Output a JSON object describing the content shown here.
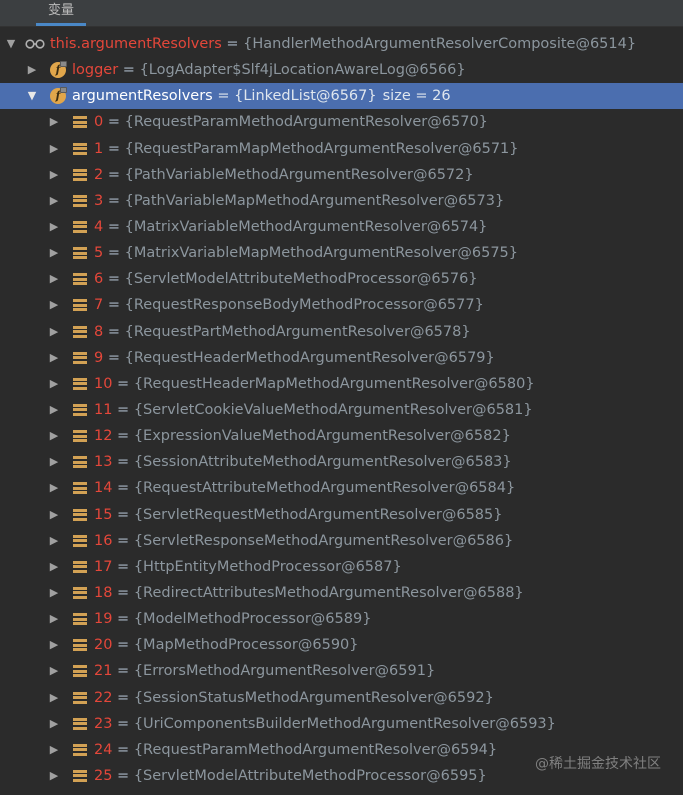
{
  "tab": {
    "label": "变量"
  },
  "root": {
    "name": "this.argumentResolvers",
    "eq": " = ",
    "value": "{HandlerMethodArgumentResolverComposite@6514}"
  },
  "logger": {
    "name": "logger",
    "eq": " = ",
    "value": "{LogAdapter$Slf4jLocationAwareLog@6566}"
  },
  "resolvers": {
    "name": "argumentResolvers",
    "eq": " = ",
    "value": "{LinkedList@6567}",
    "size": "size = 26"
  },
  "items": [
    {
      "index": "0",
      "value": "{RequestParamMethodArgumentResolver@6570}"
    },
    {
      "index": "1",
      "value": "{RequestParamMapMethodArgumentResolver@6571}"
    },
    {
      "index": "2",
      "value": "{PathVariableMethodArgumentResolver@6572}"
    },
    {
      "index": "3",
      "value": "{PathVariableMapMethodArgumentResolver@6573}"
    },
    {
      "index": "4",
      "value": "{MatrixVariableMethodArgumentResolver@6574}"
    },
    {
      "index": "5",
      "value": "{MatrixVariableMapMethodArgumentResolver@6575}"
    },
    {
      "index": "6",
      "value": "{ServletModelAttributeMethodProcessor@6576}"
    },
    {
      "index": "7",
      "value": "{RequestResponseBodyMethodProcessor@6577}"
    },
    {
      "index": "8",
      "value": "{RequestPartMethodArgumentResolver@6578}"
    },
    {
      "index": "9",
      "value": "{RequestHeaderMethodArgumentResolver@6579}"
    },
    {
      "index": "10",
      "value": "{RequestHeaderMapMethodArgumentResolver@6580}"
    },
    {
      "index": "11",
      "value": "{ServletCookieValueMethodArgumentResolver@6581}"
    },
    {
      "index": "12",
      "value": "{ExpressionValueMethodArgumentResolver@6582}"
    },
    {
      "index": "13",
      "value": "{SessionAttributeMethodArgumentResolver@6583}"
    },
    {
      "index": "14",
      "value": "{RequestAttributeMethodArgumentResolver@6584}"
    },
    {
      "index": "15",
      "value": "{ServletRequestMethodArgumentResolver@6585}"
    },
    {
      "index": "16",
      "value": "{ServletResponseMethodArgumentResolver@6586}"
    },
    {
      "index": "17",
      "value": "{HttpEntityMethodProcessor@6587}"
    },
    {
      "index": "18",
      "value": "{RedirectAttributesMethodArgumentResolver@6588}"
    },
    {
      "index": "19",
      "value": "{ModelMethodProcessor@6589}"
    },
    {
      "index": "20",
      "value": "{MapMethodProcessor@6590}"
    },
    {
      "index": "21",
      "value": "{ErrorsMethodArgumentResolver@6591}"
    },
    {
      "index": "22",
      "value": "{SessionStatusMethodArgumentResolver@6592}"
    },
    {
      "index": "23",
      "value": "{UriComponentsBuilderMethodArgumentResolver@6593}"
    },
    {
      "index": "24",
      "value": "{RequestParamMethodArgumentResolver@6594}"
    },
    {
      "index": "25",
      "value": "{ServletModelAttributeMethodProcessor@6595}"
    }
  ],
  "watermark": "@稀土掘金技术社区",
  "colors": {
    "selected": "#4b6eaf",
    "name": "#e4473a",
    "value": "#8c969e",
    "background": "#2b2b2b"
  },
  "icons": {
    "watch": "glasses-icon",
    "field": "field-icon",
    "element": "list-icon"
  }
}
